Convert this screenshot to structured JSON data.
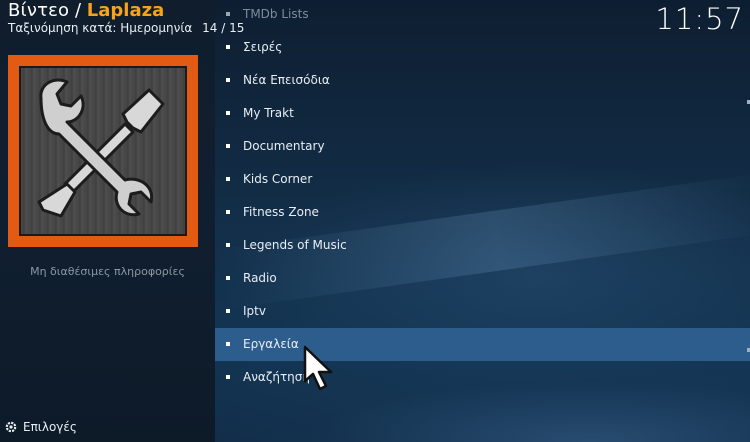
{
  "header": {
    "section": "Βίντεο",
    "separator": " / ",
    "addon": "Laplaza",
    "sort_label": "Ταξινόμηση κατά: Ημερομηνία",
    "position": "14 / 15",
    "clock": "11:57"
  },
  "info": {
    "no_info": "Μη διαθέσιμες πληροφορίες"
  },
  "footer": {
    "options_label": "Επιλογές"
  },
  "menu": {
    "items": [
      {
        "label": "TMDb Lists"
      },
      {
        "label": "Σειρές"
      },
      {
        "label": "Νέα Επεισόδια"
      },
      {
        "label": "My Trakt"
      },
      {
        "label": "Documentary"
      },
      {
        "label": "Kids Corner"
      },
      {
        "label": "Fitness Zone"
      },
      {
        "label": "Legends of Music"
      },
      {
        "label": "Radio"
      },
      {
        "label": "Iptv"
      },
      {
        "label": "Εργαλεία"
      },
      {
        "label": "Αναζήτηση"
      }
    ],
    "selected_index": 10
  },
  "colors": {
    "accent": "#f7a21b",
    "selection": "#2d5d8c",
    "thumb_frame": "#e35b12"
  },
  "icons": {
    "thumbnail": "wrench-screwdriver-icon",
    "options": "gear-icon",
    "pointer": "mouse-cursor-icon"
  }
}
